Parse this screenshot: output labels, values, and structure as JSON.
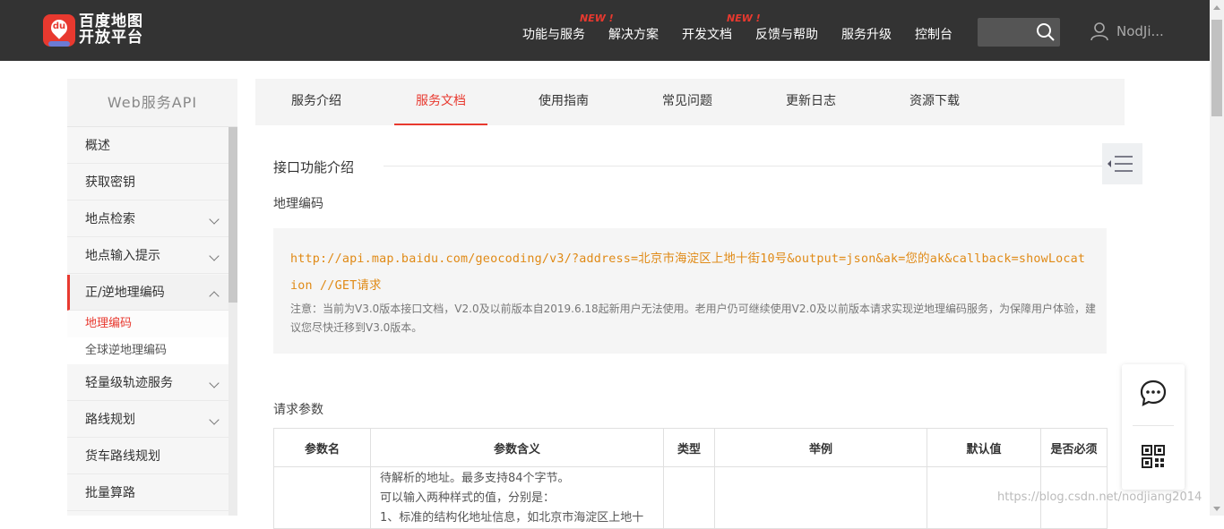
{
  "header": {
    "brand_line1": "百度地图",
    "brand_line2": "开放平台",
    "logo_text": "du",
    "nav": [
      {
        "label": "功能与服务",
        "badge": "NEW !"
      },
      {
        "label": "解决方案",
        "badge": ""
      },
      {
        "label": "开发文档",
        "badge": "NEW !"
      },
      {
        "label": "反馈与帮助",
        "badge": ""
      },
      {
        "label": "服务升级",
        "badge": ""
      },
      {
        "label": "控制台",
        "badge": ""
      }
    ],
    "search_value": "",
    "username": "NodJi..."
  },
  "sidebar": {
    "title": "Web服务API",
    "items": [
      {
        "label": "概述",
        "expandable": false
      },
      {
        "label": "获取密钥",
        "expandable": false
      },
      {
        "label": "地点检索",
        "expandable": true
      },
      {
        "label": "地点输入提示",
        "expandable": true
      },
      {
        "label": "正/逆地理编码",
        "expandable": true,
        "expanded": true
      },
      {
        "label": "轻量级轨迹服务",
        "expandable": true
      },
      {
        "label": "路线规划",
        "expandable": true
      },
      {
        "label": "货车路线规划",
        "expandable": false
      },
      {
        "label": "批量算路",
        "expandable": false
      }
    ],
    "subitems": [
      {
        "label": "地理编码",
        "current": true
      },
      {
        "label": "全球逆地理编码",
        "current": false
      }
    ]
  },
  "tabs": [
    {
      "label": "服务介绍"
    },
    {
      "label": "服务文档",
      "active": true
    },
    {
      "label": "使用指南"
    },
    {
      "label": "常见问题"
    },
    {
      "label": "更新日志"
    },
    {
      "label": "资源下载"
    }
  ],
  "content": {
    "section_title": "接口功能介绍",
    "subsection_title": "地理编码",
    "request_url": "http://api.map.baidu.com/geocoding/v3/?address=北京市海淀区上地十街10号&output=json&ak=您的ak&callback=showLocation //GET请求",
    "note": "注意：当前为V3.0版本接口文档，V2.0及以前版本自2019.6.18起新用户无法使用。老用户仍可继续使用V2.0及以前版本请求实现逆地理编码服务，为保障用户体验，建议您尽快迁移到V3.0版本。",
    "params_title": "请求参数",
    "table": {
      "headers": [
        "参数名",
        "参数含义",
        "类型",
        "举例",
        "默认值",
        "是否必须"
      ],
      "row1_desc": [
        "待解析的地址。最多支持84个字节。",
        "可以输入两种样式的值，分别是：",
        "1、标准的结构化地址信息，如北京市海淀区上地十"
      ]
    }
  },
  "watermark": "https://blog.csdn.net/nodjiang2014"
}
